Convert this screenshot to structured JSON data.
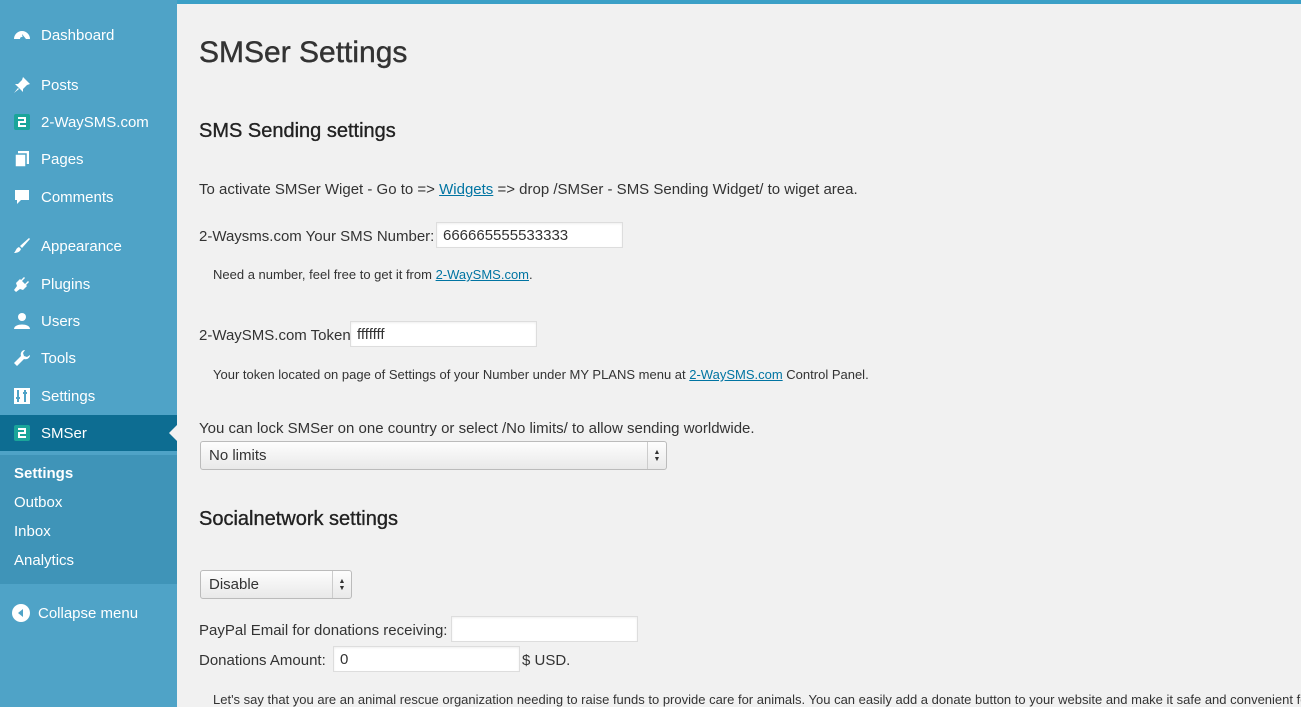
{
  "sidebar": {
    "items": [
      {
        "label": "Dashboard",
        "icon": "dashboard-icon"
      },
      {
        "label": "Posts",
        "icon": "pin-icon"
      },
      {
        "label": "2-WaySMS.com",
        "icon": "two-way-sms-icon"
      },
      {
        "label": "Pages",
        "icon": "pages-icon"
      },
      {
        "label": "Comments",
        "icon": "comment-icon"
      },
      {
        "label": "Appearance",
        "icon": "brush-icon"
      },
      {
        "label": "Plugins",
        "icon": "plug-icon"
      },
      {
        "label": "Users",
        "icon": "user-icon"
      },
      {
        "label": "Tools",
        "icon": "wrench-icon"
      },
      {
        "label": "Settings",
        "icon": "sliders-icon"
      },
      {
        "label": "SMSer",
        "icon": "two-way-sms-icon"
      }
    ],
    "submenu": [
      "Settings",
      "Outbox",
      "Inbox",
      "Analytics"
    ],
    "collapse_label": "Collapse menu"
  },
  "page": {
    "title": "SMSer Settings",
    "sms_section_title": "SMS Sending settings",
    "activate_prefix": "To activate SMSer Wiget - Go to =>",
    "activate_link": "Widgets",
    "activate_suffix": "=> drop /SMSer - SMS Sending Widget/ to wiget area.",
    "number_label": "2-Waysms.com Your SMS Number:",
    "number_value": "666665555533333",
    "number_help_prefix": "Need a number, feel free to get it from",
    "number_help_link": "2-WaySMS.com",
    "number_help_suffix": ".",
    "token_label": "2-WaySMS.com Token",
    "token_value": "fffffff",
    "token_help_prefix": "Your token located on page of Settings of your Number under MY PLANS menu at",
    "token_help_link": "2-WaySMS.com",
    "token_help_suffix": "Control Panel.",
    "country_text": "You can lock SMSer on one country or select /No limits/ to allow sending worldwide.",
    "country_select": "No limits",
    "social_section_title": "Socialnetwork settings",
    "social_select": "Disable",
    "paypal_label": "PayPal Email for donations receiving:",
    "paypal_value": "",
    "donation_label": "Donations Amount:",
    "donation_value": "0",
    "donation_unit": "$ USD.",
    "bottom_text": "Let's say that you are an animal rescue organization needing to raise funds to provide care for animals. You can easily add a donate button to your website and make it safe and convenient for supp"
  },
  "colors": {
    "sidebar_bg": "#4fa3c7",
    "sidebar_active": "#0d6d92",
    "link": "#0074a2"
  }
}
